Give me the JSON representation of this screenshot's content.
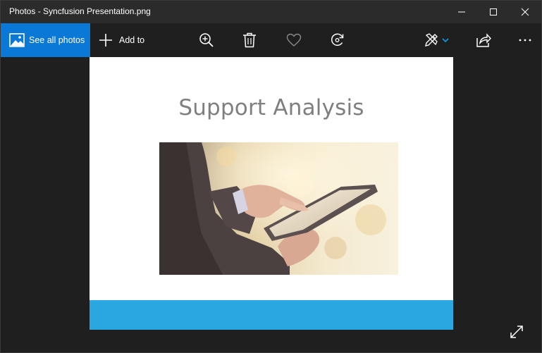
{
  "window": {
    "title": "Photos - Syncfusion Presentation.png"
  },
  "toolbar": {
    "see_all_photos_label": "See all photos",
    "add_to_label": "Add to"
  },
  "slide": {
    "title": "Support Analysis"
  },
  "colors": {
    "accent": "#0a78d7",
    "slide_footer": "#29a8df",
    "titlebar": "#2b2b2b",
    "background": "#1f1f1f",
    "slide_title_text": "#7f7f7f"
  },
  "icons": {
    "see_all": "photos-icon",
    "add_to": "plus-icon",
    "zoom": "zoom-in-icon",
    "delete": "trash-icon",
    "favorite": "heart-icon",
    "rotate": "rotate-icon",
    "edit": "edit-create-icon",
    "share": "share-icon",
    "more": "more-icon",
    "fullscreen": "fullscreen-icon",
    "minimize": "minimize-icon",
    "maximize": "maximize-icon",
    "close": "close-icon"
  }
}
